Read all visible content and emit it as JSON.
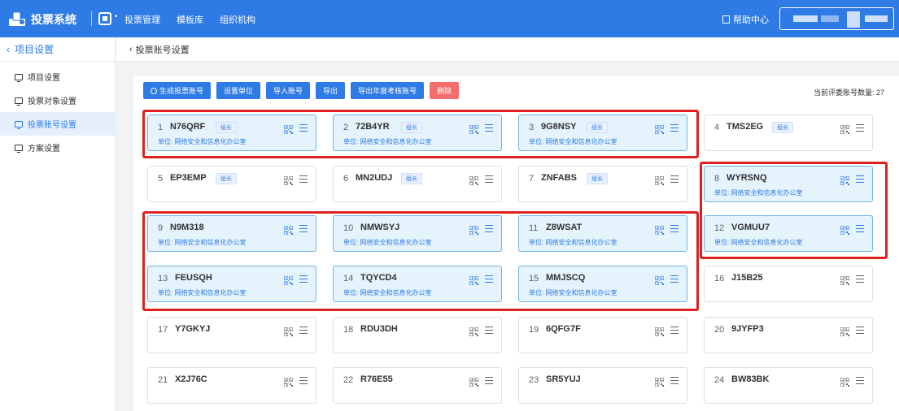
{
  "topbar": {
    "app_title": "投票系统",
    "nav": [
      "投票管理",
      "模板库",
      "组织机构"
    ],
    "help": "帮助中心"
  },
  "sidebar": {
    "back_label": "项目设置",
    "items": [
      {
        "label": "项目设置",
        "active": false
      },
      {
        "label": "投票对象设置",
        "active": false
      },
      {
        "label": "投票账号设置",
        "active": true
      },
      {
        "label": "方案设置",
        "active": false
      }
    ]
  },
  "page": {
    "breadcrumb": "投票账号设置"
  },
  "toolbar": {
    "generate": "生成投票账号",
    "set_unit": "设置单位",
    "import": "导入账号",
    "export": "导出",
    "export_annual": "导出年度考核账号",
    "delete": "删除"
  },
  "count_label": "当前评委账号数量: 27",
  "accounts": [
    {
      "num": "1",
      "code": "N76QRF",
      "tag": "组长",
      "unit": "单位: 网络安全和信息化办公室",
      "selected": true
    },
    {
      "num": "2",
      "code": "72B4YR",
      "tag": "组长",
      "unit": "单位: 网络安全和信息化办公室",
      "selected": true
    },
    {
      "num": "3",
      "code": "9G8NSY",
      "tag": "组长",
      "unit": "单位: 网络安全和信息化办公室",
      "selected": true
    },
    {
      "num": "4",
      "code": "TMS2EG",
      "tag": "组长",
      "unit": "",
      "selected": false
    },
    {
      "num": "5",
      "code": "EP3EMP",
      "tag": "组长",
      "unit": "",
      "selected": false
    },
    {
      "num": "6",
      "code": "MN2UDJ",
      "tag": "组长",
      "unit": "",
      "selected": false
    },
    {
      "num": "7",
      "code": "ZNFABS",
      "tag": "组长",
      "unit": "",
      "selected": false
    },
    {
      "num": "8",
      "code": "WYRSNQ",
      "tag": "",
      "unit": "单位: 网络安全和信息化办公室",
      "selected": true
    },
    {
      "num": "9",
      "code": "N9M318",
      "tag": "",
      "unit": "单位: 网络安全和信息化办公室",
      "selected": true
    },
    {
      "num": "10",
      "code": "NMWSYJ",
      "tag": "",
      "unit": "单位: 网络安全和信息化办公室",
      "selected": true
    },
    {
      "num": "11",
      "code": "Z8WSAT",
      "tag": "",
      "unit": "单位: 网络安全和信息化办公室",
      "selected": true
    },
    {
      "num": "12",
      "code": "VGMUU7",
      "tag": "",
      "unit": "单位: 网络安全和信息化办公室",
      "selected": true
    },
    {
      "num": "13",
      "code": "FEUSQH",
      "tag": "",
      "unit": "单位: 网络安全和信息化办公室",
      "selected": true
    },
    {
      "num": "14",
      "code": "TQYCD4",
      "tag": "",
      "unit": "单位: 网络安全和信息化办公室",
      "selected": true
    },
    {
      "num": "15",
      "code": "MMJSCQ",
      "tag": "",
      "unit": "单位: 网络安全和信息化办公室",
      "selected": true
    },
    {
      "num": "16",
      "code": "J15B25",
      "tag": "",
      "unit": "",
      "selected": false
    },
    {
      "num": "17",
      "code": "Y7GKYJ",
      "tag": "",
      "unit": "",
      "selected": false
    },
    {
      "num": "18",
      "code": "RDU3DH",
      "tag": "",
      "unit": "",
      "selected": false
    },
    {
      "num": "19",
      "code": "6QFG7F",
      "tag": "",
      "unit": "",
      "selected": false
    },
    {
      "num": "20",
      "code": "9JYFP3",
      "tag": "",
      "unit": "",
      "selected": false
    },
    {
      "num": "21",
      "code": "X2J76C",
      "tag": "",
      "unit": "",
      "selected": false
    },
    {
      "num": "22",
      "code": "R76E55",
      "tag": "",
      "unit": "",
      "selected": false
    },
    {
      "num": "23",
      "code": "SR5YUJ",
      "tag": "",
      "unit": "",
      "selected": false
    },
    {
      "num": "24",
      "code": "BW83BK",
      "tag": "",
      "unit": "",
      "selected": false
    }
  ],
  "colors": {
    "primary": "#2f7be6",
    "danger": "#f56c6c",
    "selected_bg": "#e5f3fc",
    "annotation": "#e02020"
  }
}
